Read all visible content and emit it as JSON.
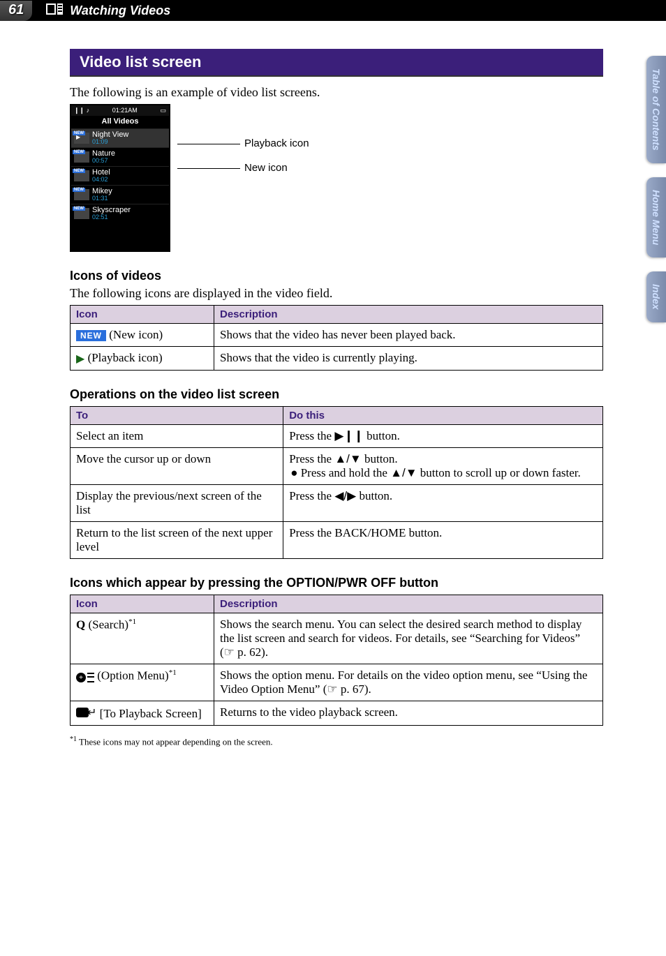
{
  "header": {
    "page_number": "61",
    "section_title": "Watching Videos"
  },
  "side_tabs": {
    "toc": "Table of\nContents",
    "home": "Home\nMenu",
    "index": "Index"
  },
  "section_bar": "Video list screen",
  "intro_text": "The following is an example of video list screens.",
  "device_screen": {
    "time": "01:21AM",
    "title": "All Videos",
    "items": [
      {
        "name": "Night View",
        "duration": "01:09",
        "new": true,
        "playing": true
      },
      {
        "name": "Nature",
        "duration": "00:57",
        "new": true
      },
      {
        "name": "Hotel",
        "duration": "04:02",
        "new": true
      },
      {
        "name": "Mikey",
        "duration": "01:31",
        "new": true
      },
      {
        "name": "Skyscraper",
        "duration": "02:51",
        "new": true
      }
    ]
  },
  "callouts": {
    "playback": "Playback icon",
    "new": "New icon"
  },
  "icons_section": {
    "heading": "Icons of videos",
    "intro": "The following icons are displayed in the video field.",
    "col_icon": "Icon",
    "col_desc": "Description",
    "rows": [
      {
        "label": "(New icon)",
        "desc": "Shows that the video has never been played back."
      },
      {
        "label": "(Playback icon)",
        "desc": "Shows that the video is currently playing."
      }
    ]
  },
  "ops_section": {
    "heading": "Operations on the video list screen",
    "col_to": "To",
    "col_do": "Do this",
    "rows": {
      "r0_to": "Select an item",
      "r0_do_a": "Press the ",
      "r0_do_b": " button.",
      "r1_to": "Move the cursor up or down",
      "r1_do_a": "Press the ",
      "r1_do_b": " button.",
      "r1_do_c": "Press and hold the ",
      "r1_do_d": " button to scroll up or down faster.",
      "r2_to": "Display the previous/next screen of the list",
      "r2_do_a": "Press the ",
      "r2_do_b": " button.",
      "r3_to": "Return to the list screen of the next upper level",
      "r3_do": "Press the BACK/HOME button."
    }
  },
  "opt_section": {
    "heading": "Icons which appear by pressing the OPTION/PWR OFF button",
    "col_icon": "Icon",
    "col_desc": "Description",
    "rows": {
      "r0_label": "(Search)",
      "r0_desc_a": "Shows the search menu. You can select the desired search method to display the list screen and search for videos. For details, see “Searching for Videos” (",
      "r0_desc_b": " p. 62).",
      "r1_label": "(Option Menu)",
      "r1_desc_a": "Shows the option menu. For details on the video option menu, see “Using the Video Option Menu” (",
      "r1_desc_b": " p. 67).",
      "r2_label": "[To Playback Screen]",
      "r2_desc": "Returns to the video playback screen."
    }
  },
  "footnote": "These icons may not appear depending on the screen.",
  "symbols": {
    "play_pause": "▶❙❙",
    "up_down": "▲/▼",
    "left_right": "◀/▶",
    "pointer": "☞",
    "new_badge": "NEW",
    "sup1": "*1"
  }
}
